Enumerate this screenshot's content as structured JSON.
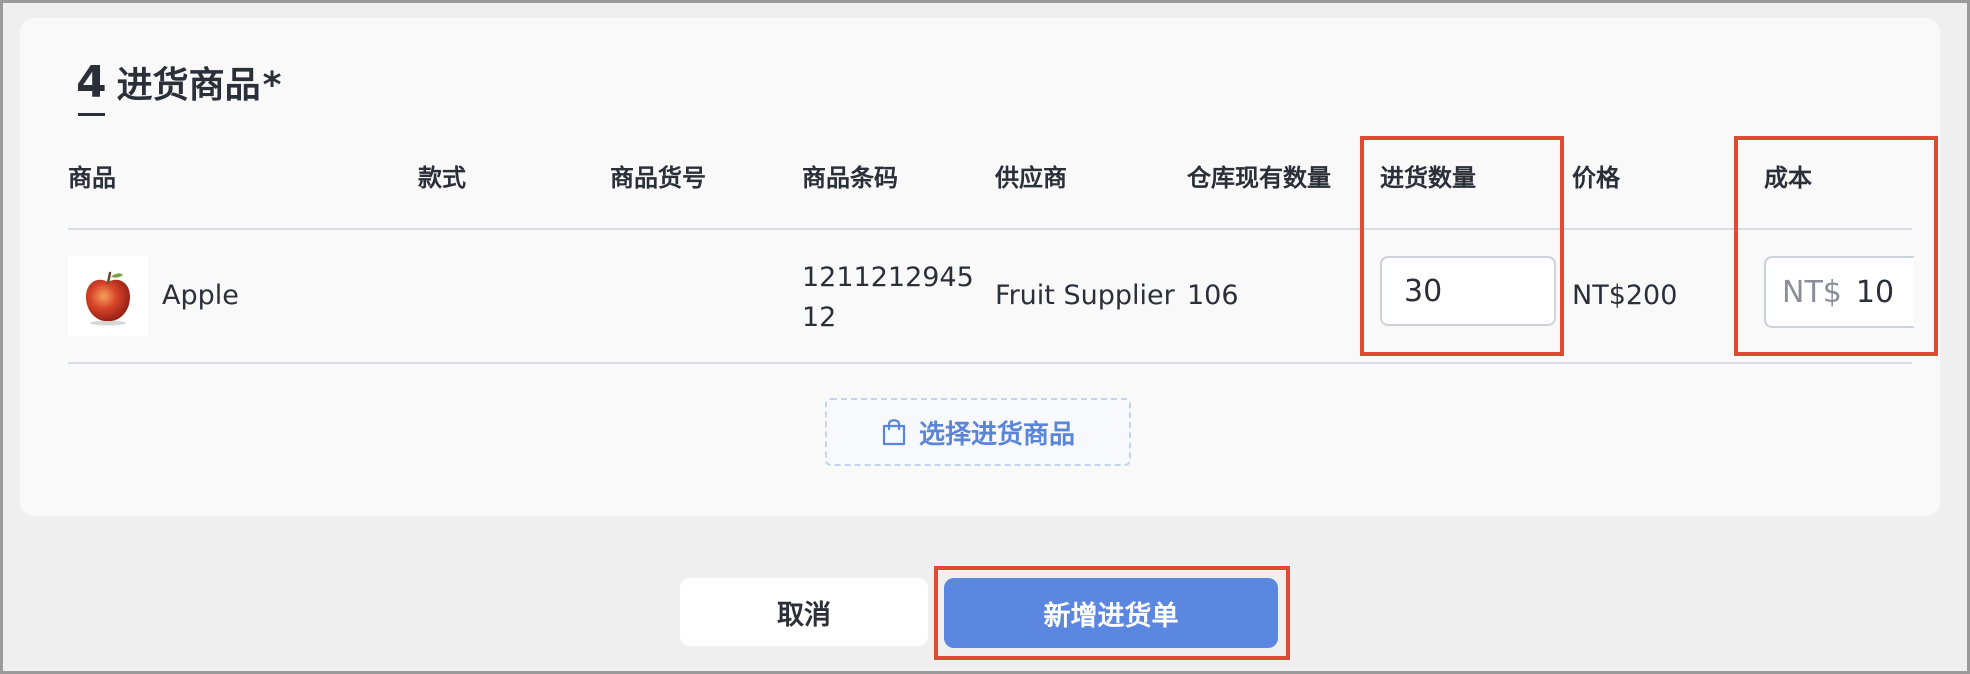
{
  "section": {
    "step_number": "4",
    "title": "进货商品",
    "required_mark": "*"
  },
  "table": {
    "headers": {
      "product": "商品",
      "style": "款式",
      "sku": "商品货号",
      "barcode": "商品条码",
      "supplier": "供应商",
      "stock": "仓库现有数量",
      "quantity": "进货数量",
      "price": "价格",
      "cost": "成本"
    },
    "row": {
      "product_name": "Apple",
      "style": "",
      "sku": "",
      "barcode_line1": "1211212945",
      "barcode_line2": "12",
      "supplier": "Fruit Supplier",
      "stock": "106",
      "quantity_value": "30",
      "price": "NT$200",
      "cost_prefix": "NT$",
      "cost_value": "10"
    }
  },
  "actions": {
    "select_products_label": "选择进货商品",
    "cancel_label": "取消",
    "submit_label": "新增进货单"
  },
  "colors": {
    "primary": "#5b87e0",
    "highlight": "#e04a32",
    "dashed_button_text": "#5b86d8"
  },
  "icons": {
    "select_products": "shopping-bag-icon",
    "product_image": "apple-image"
  }
}
